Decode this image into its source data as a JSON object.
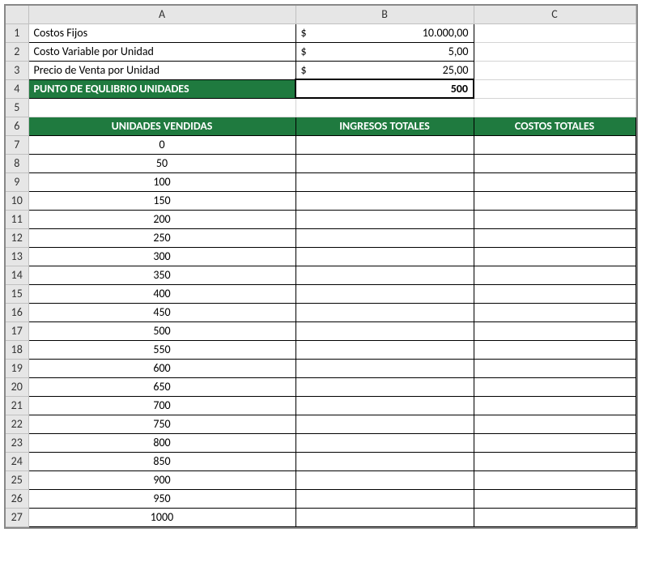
{
  "columns": [
    "A",
    "B",
    "C"
  ],
  "row_numbers": [
    1,
    2,
    3,
    4,
    5,
    6,
    7,
    8,
    9,
    10,
    11,
    12,
    13,
    14,
    15,
    16,
    17,
    18,
    19,
    20,
    21,
    22,
    23,
    24,
    25,
    26,
    27
  ],
  "inputs": {
    "row1": {
      "label": "Costos Fijos",
      "symbol": "$",
      "value": "10.000,00"
    },
    "row2": {
      "label": "Costo Variable por Unidad",
      "symbol": "$",
      "value": "5,00"
    },
    "row3": {
      "label": "Precio de Venta por Unidad",
      "symbol": "$",
      "value": "25,00"
    },
    "row4": {
      "label": "PUNTO DE EQULIBRIO UNIDADES",
      "value": "500"
    }
  },
  "table_headers": {
    "colA": "UNIDADES VENDIDAS",
    "colB": "INGRESOS TOTALES",
    "colC": "COSTOS TOTALES"
  },
  "units": [
    "0",
    "50",
    "100",
    "150",
    "200",
    "250",
    "300",
    "350",
    "400",
    "450",
    "500",
    "550",
    "600",
    "650",
    "700",
    "750",
    "800",
    "850",
    "900",
    "950",
    "1000"
  ],
  "chart_data": {
    "type": "table",
    "title": "Break-even analysis inputs",
    "rows": [
      {
        "label": "Costos Fijos",
        "value": 10000.0
      },
      {
        "label": "Costo Variable por Unidad",
        "value": 5.0
      },
      {
        "label": "Precio de Venta por Unidad",
        "value": 25.0
      },
      {
        "label": "PUNTO DE EQULIBRIO UNIDADES",
        "value": 500
      }
    ],
    "series_table": {
      "columns": [
        "UNIDADES VENDIDAS",
        "INGRESOS TOTALES",
        "COSTOS TOTALES"
      ],
      "unidades_vendidas": [
        0,
        50,
        100,
        150,
        200,
        250,
        300,
        350,
        400,
        450,
        500,
        550,
        600,
        650,
        700,
        750,
        800,
        850,
        900,
        950,
        1000
      ]
    }
  }
}
